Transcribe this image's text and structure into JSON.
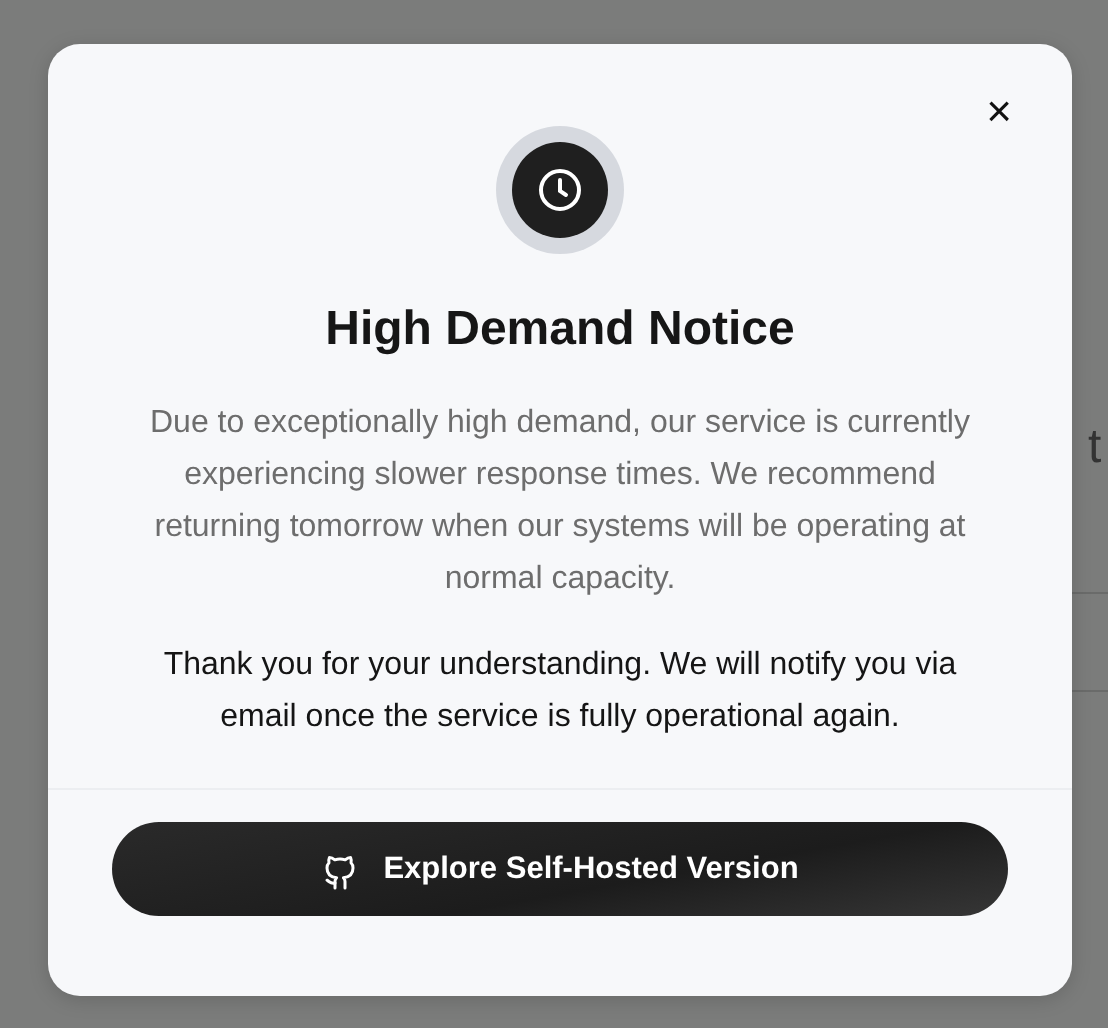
{
  "background": {
    "text": "t"
  },
  "dialog": {
    "title": "High Demand Notice",
    "message": "Due to exceptionally high demand, our service is currently experiencing slower response times. We recommend returning tomorrow when our systems will be operating at normal capacity.",
    "note": "Thank you for your understanding. We will notify you via email once the service is fully operational again.",
    "close": "×",
    "button": "Explore Self-Hosted Version"
  }
}
